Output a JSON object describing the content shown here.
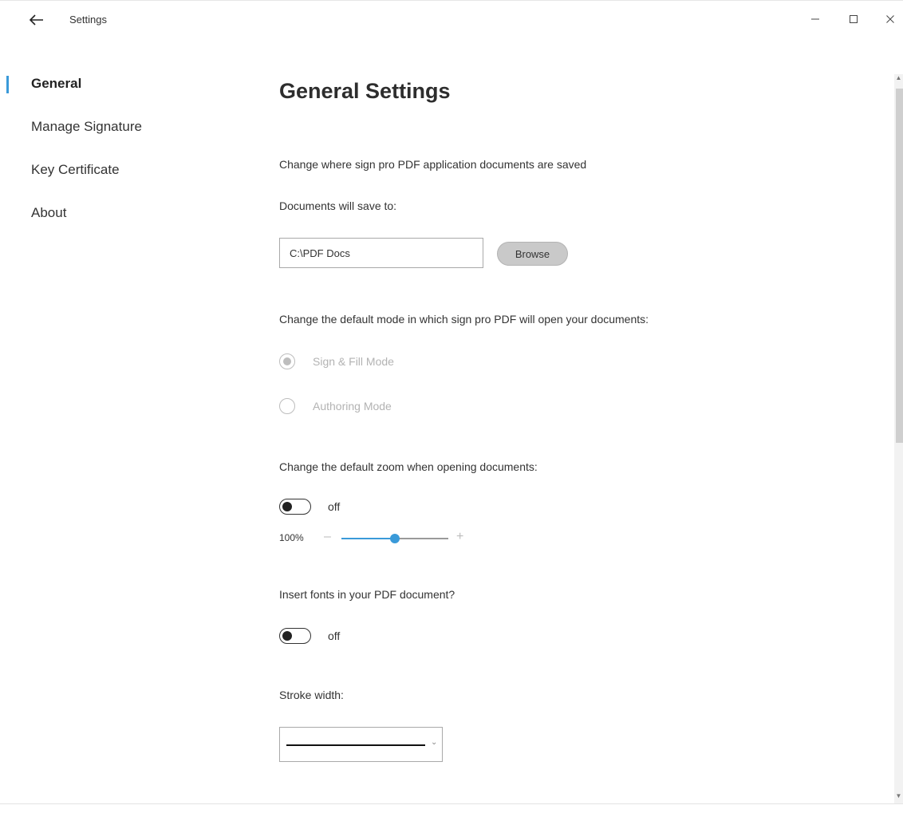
{
  "window": {
    "title": "Settings",
    "controls": {
      "minimize": "—",
      "maximize": "☐",
      "close": "✕"
    }
  },
  "sidebar": {
    "items": [
      {
        "label": "General",
        "active": true
      },
      {
        "label": "Manage Signature",
        "active": false
      },
      {
        "label": "Key Certificate",
        "active": false
      },
      {
        "label": "About",
        "active": false
      }
    ],
    "accent_color": "#3a9ad9"
  },
  "main": {
    "title": "General Settings",
    "save_location": {
      "description": "Change where sign pro PDF application documents are saved",
      "label": "Documents will save to:",
      "path_value": "C:\\PDF Docs",
      "browse_label": "Browse"
    },
    "open_mode": {
      "description": "Change the default mode in which sign pro PDF will open your documents:",
      "options": [
        {
          "label": "Sign & Fill Mode",
          "selected": true
        },
        {
          "label": "Authoring Mode",
          "selected": false
        }
      ]
    },
    "zoom": {
      "description": "Change the default zoom when opening documents:",
      "toggle_state": "off",
      "value_label": "100%",
      "minus": "–",
      "plus": "+",
      "slider_fraction": 0.5
    },
    "fonts": {
      "description": "Insert fonts in your PDF document?",
      "toggle_state": "off"
    },
    "stroke": {
      "label": "Stroke width:",
      "chevron": "⌄"
    }
  }
}
